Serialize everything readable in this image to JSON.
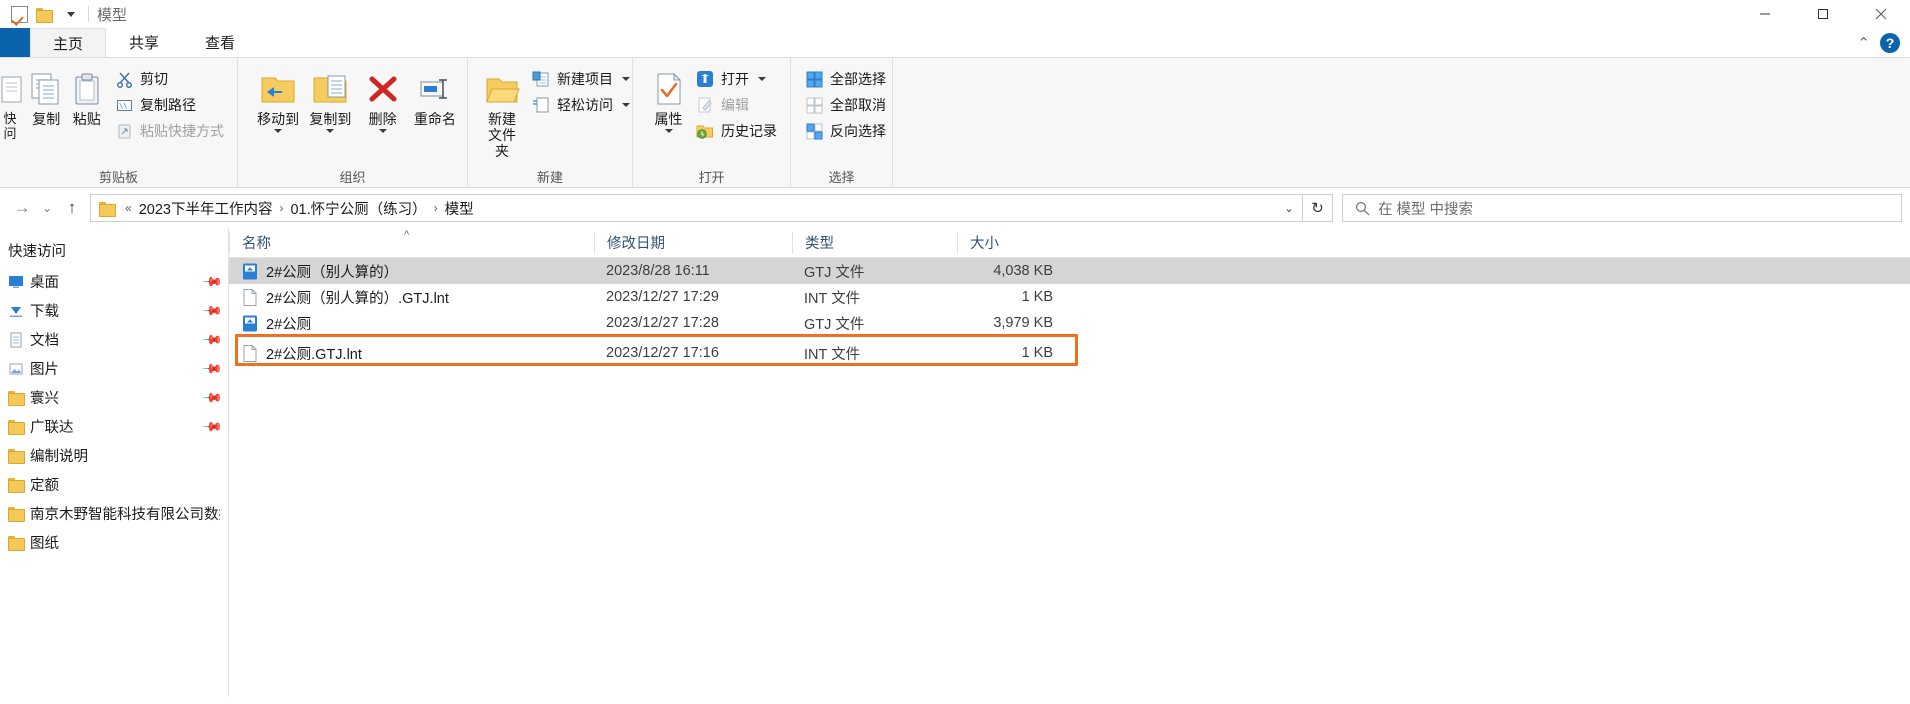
{
  "window": {
    "title": "模型",
    "quick_access": {
      "checkbox_icon": "checkmark-box-icon",
      "folder_icon": "folder-icon",
      "dropdown_icon": "chevron-down-icon"
    },
    "controls": {
      "minimize": "minimize-icon",
      "maximize": "maximize-icon",
      "close": "close-icon"
    }
  },
  "tabs": [
    {
      "label": "主页",
      "active": true
    },
    {
      "label": "共享",
      "active": false
    },
    {
      "label": "查看",
      "active": false
    }
  ],
  "tabstrip_right": {
    "collapse_icon": "chevron-up-icon",
    "help_label": "?"
  },
  "ribbon": {
    "groups": [
      {
        "label": "剪贴板",
        "big_buttons": [
          {
            "label": "固定到快速访问",
            "label_lines": [
              "快",
              "问"
            ],
            "icon": "pin-quick-access-icon"
          },
          {
            "label": "复制",
            "icon": "copy-icon"
          },
          {
            "label": "粘贴",
            "icon": "paste-icon"
          }
        ],
        "small_buttons": [
          {
            "label": "剪切",
            "icon": "scissors-icon",
            "disabled": false
          },
          {
            "label": "复制路径",
            "icon": "copy-path-icon",
            "disabled": false
          },
          {
            "label": "粘贴快捷方式",
            "icon": "paste-shortcut-icon",
            "disabled": true
          }
        ]
      },
      {
        "label": "组织",
        "big_buttons": [
          {
            "label": "移动到",
            "icon": "move-to-icon",
            "has_caret": true
          },
          {
            "label": "复制到",
            "icon": "copy-to-icon",
            "has_caret": true
          },
          {
            "label": "删除",
            "icon": "delete-icon",
            "has_caret": true
          },
          {
            "label": "重命名",
            "icon": "rename-icon",
            "has_caret": false
          }
        ],
        "small_buttons": []
      },
      {
        "label": "新建",
        "big_buttons": [
          {
            "label": "新建\n文件夹",
            "label_lines": [
              "新建",
              "文件夹"
            ],
            "icon": "new-folder-icon"
          }
        ],
        "small_buttons": [
          {
            "label": "新建项目",
            "icon": "new-item-icon",
            "has_caret": true,
            "disabled": false
          },
          {
            "label": "轻松访问",
            "icon": "easy-access-icon",
            "has_caret": true,
            "disabled": false
          }
        ]
      },
      {
        "label": "打开",
        "big_buttons": [
          {
            "label": "属性",
            "icon": "properties-icon",
            "has_caret": true
          }
        ],
        "small_buttons": [
          {
            "label": "打开",
            "icon": "open-with-icon",
            "has_caret": true,
            "disabled": false
          },
          {
            "label": "编辑",
            "icon": "edit-icon",
            "has_caret": false,
            "disabled": true
          },
          {
            "label": "历史记录",
            "icon": "history-icon",
            "has_caret": false,
            "disabled": false
          }
        ]
      },
      {
        "label": "选择",
        "big_buttons": [],
        "small_buttons": [
          {
            "label": "全部选择",
            "icon": "select-all-icon",
            "disabled": false
          },
          {
            "label": "全部取消",
            "icon": "select-none-icon",
            "disabled": false
          },
          {
            "label": "反向选择",
            "icon": "invert-selection-icon",
            "disabled": false
          }
        ]
      }
    ]
  },
  "nav": {
    "back_icon": "arrow-left-icon",
    "forward_icon": "arrow-right-icon",
    "recent_icon": "chevron-down-icon",
    "up_icon": "arrow-up-icon",
    "refresh_icon": "refresh-icon",
    "address": {
      "folder_icon": "folder-icon",
      "overflow": "«",
      "crumbs": [
        "2023下半年工作内容",
        "01.怀宁公厕（练习）",
        "模型"
      ],
      "separator": "›",
      "dropdown_icon": "chevron-down-icon"
    },
    "search": {
      "icon": "search-icon",
      "placeholder": "在 模型 中搜索",
      "value": ""
    }
  },
  "sidebar": {
    "header": "快速访问",
    "items": [
      {
        "label": "桌面",
        "icon": "desktop-icon",
        "pinned": true
      },
      {
        "label": "下载",
        "icon": "downloads-icon",
        "pinned": true
      },
      {
        "label": "文档",
        "icon": "documents-icon",
        "pinned": true
      },
      {
        "label": "图片",
        "icon": "pictures-icon",
        "pinned": true
      },
      {
        "label": "寰兴",
        "icon": "folder-icon",
        "pinned": true
      },
      {
        "label": "广联达",
        "icon": "folder-icon",
        "pinned": true
      },
      {
        "label": "编制说明",
        "icon": "folder-icon",
        "pinned": false
      },
      {
        "label": "定额",
        "icon": "folder-icon",
        "pinned": false
      },
      {
        "label": "南京木野智能科技有限公司数控力",
        "icon": "folder-icon",
        "pinned": false
      },
      {
        "label": "图纸",
        "icon": "folder-icon",
        "pinned": false
      }
    ]
  },
  "filelist": {
    "columns": [
      {
        "key": "name",
        "label": "名称",
        "sorted": true,
        "sort_dir": "asc"
      },
      {
        "key": "date",
        "label": "修改日期",
        "sorted": false
      },
      {
        "key": "type",
        "label": "类型",
        "sorted": false
      },
      {
        "key": "size",
        "label": "大小",
        "sorted": false
      }
    ],
    "rows": [
      {
        "name": "2#公厕（别人算的）",
        "date": "2023/8/28 16:11",
        "type": "GTJ 文件",
        "size": "4,038 KB",
        "icon": "gtj-file-icon",
        "selected": true,
        "highlighted": false
      },
      {
        "name": "2#公厕（别人算的）.GTJ.lnt",
        "date": "2023/12/27 17:29",
        "type": "INT 文件",
        "size": "1 KB",
        "icon": "generic-file-icon",
        "selected": false,
        "highlighted": false
      },
      {
        "name": "2#公厕",
        "date": "2023/12/27 17:28",
        "type": "GTJ 文件",
        "size": "3,979 KB",
        "icon": "gtj-file-icon",
        "selected": false,
        "highlighted": false
      },
      {
        "name": "2#公厕.GTJ.lnt",
        "date": "2023/12/27 17:16",
        "type": "INT 文件",
        "size": "1 KB",
        "icon": "generic-file-icon",
        "selected": false,
        "highlighted": true
      }
    ]
  },
  "colors": {
    "accent": "#0b63ad",
    "highlight_box": "#f07020",
    "selection": "#d5d5d5",
    "column_header_text": "#34557a",
    "folder_yellow": "#f6cc5e"
  }
}
